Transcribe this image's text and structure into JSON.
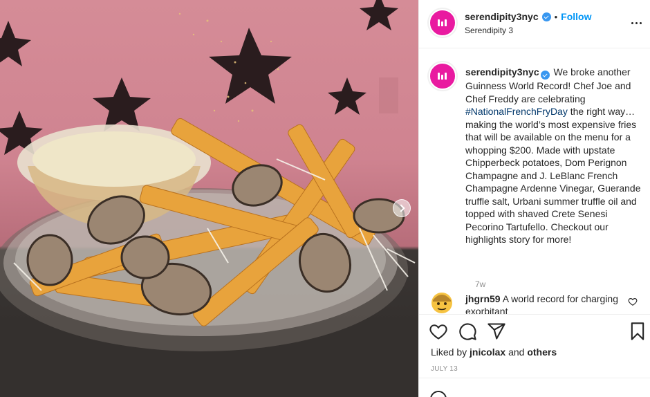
{
  "post": {
    "username": "serendipity3nyc",
    "follow_label": "Follow",
    "separator": "•",
    "location": "Serendipity 3",
    "caption_before_hashtag": "We broke another Guinness World Record! Chef Joe and Chef Freddy are celebrating ",
    "hashtag": "#NationalFrenchFryDay",
    "caption_after_hashtag": " the right way… making the world’s most expensive fries that will be available on the menu for a whopping $200. Made with upstate Chipperbeck potatoes, Dom Perignon Champagne and J. LeBlanc French Champagne Ardenne Vinegar, Guerande truffle salt, Urbani summer truffle oil and topped with shaved Crete Senesi Pecorino Tartufello. Checkout our highlights story for more!",
    "time_ago": "7w",
    "date": "JULY 13"
  },
  "comment": {
    "username": "jhgrn59",
    "text": "A world record for charging exorbitant"
  },
  "likes": {
    "prefix": "Liked by ",
    "user": "jnicolax",
    "conjunction": " and ",
    "others": "others"
  },
  "icons": {
    "more": "more-options-icon",
    "like": "heart-icon",
    "comment": "comment-icon",
    "share": "share-icon",
    "save": "bookmark-icon",
    "verified": "verified-badge-icon",
    "next": "chevron-right-icon"
  },
  "colors": {
    "link_blue": "#0095f6",
    "hashtag": "#00376b",
    "avatar": "#e91aa0",
    "muted": "#8e8e8e",
    "photo_wall": "#d58c97"
  }
}
